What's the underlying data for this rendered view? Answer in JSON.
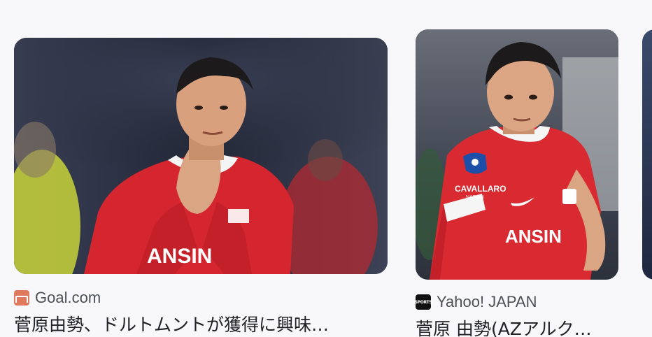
{
  "results": [
    {
      "source": "Goal.com",
      "favicon": "goal-favicon-icon",
      "headline": "菅原由勢、ドルトムントが獲得に興味…",
      "jersey_text": "ANSIN",
      "accent": "#d32f2f"
    },
    {
      "source": "Yahoo! JAPAN",
      "favicon": "yahoo-sports-favicon-icon",
      "favicon_text": "SPORTS",
      "headline": "菅原 由勢(AZアルク…",
      "jersey_text": "ANSIN",
      "sponsor_text": "CAVALLARO",
      "sponsor_sub": "NAPOLI",
      "accent": "#d32f2f"
    }
  ]
}
